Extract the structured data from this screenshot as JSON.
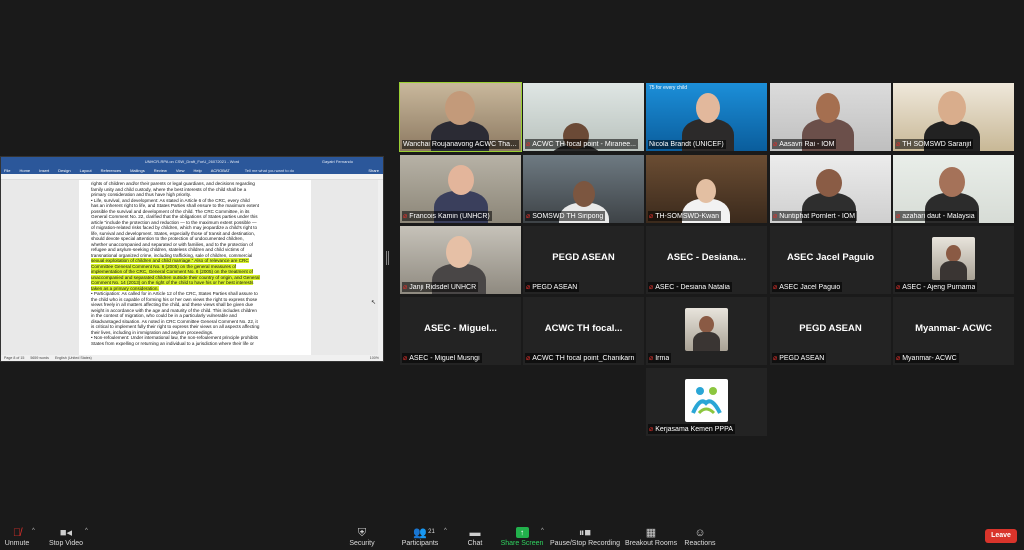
{
  "shared_doc": {
    "title": "UNHCR-RPA on CSW_Draft_ForU_26072021 - Word",
    "user": "Gayatri Fernando",
    "ribbon": [
      "File",
      "Home",
      "Insert",
      "Design",
      "Layout",
      "References",
      "Mailings",
      "Review",
      "View",
      "Help",
      "ACROBAT"
    ],
    "tell_me": "Tell me what you want to do",
    "share": "Share",
    "status": {
      "page": "Page 8 of 15",
      "words": "5659 words",
      "language": "English (United States)",
      "zoom": "100%"
    },
    "lines": [
      {
        "n": "",
        "text": "rights of children and/or their parents or legal guardians, and decisions regarding",
        "hl": false
      },
      {
        "n": "",
        "text": "family unity and child custody, where the best interests of the child shall be a",
        "hl": false
      },
      {
        "n": "",
        "text": "primary consideration and thus have high priority.",
        "hl": false
      },
      {
        "n": "",
        "text": "• Life, survival, and development: As stated in Article 6 of the CRC, every child",
        "hl": false
      },
      {
        "n": "",
        "text": "has an inherent right to life, and States Parties shall ensure to the maximum extent",
        "hl": false
      },
      {
        "n": "",
        "text": "possible the survival and development of the child. The CRC Committee, in its",
        "hl": false
      },
      {
        "n": "",
        "text": "General Comment No. 22, clarified that the obligations of States parties under this",
        "hl": false
      },
      {
        "n": "",
        "text": "article \"include the protection and reduction — to the maximum extent possible —",
        "hl": false
      },
      {
        "n": "",
        "text": "of migration-related risks faced by children, which may jeopardize a child's right to",
        "hl": false
      },
      {
        "n": "",
        "text": "life, survival and development. States, especially those of transit and destination,",
        "hl": false
      },
      {
        "n": "",
        "text": "should devote special attention to the protection of undocumented children,",
        "hl": false
      },
      {
        "n": "",
        "text": "whether unaccompanied and separated or with families, and to the protection of",
        "hl": false
      },
      {
        "n": "",
        "text": "refugee and asylum-seeking children, stateless children and child victims of",
        "hl": false
      },
      {
        "n": "",
        "text": "transnational organized crime, including trafficking, sale of children, commercial",
        "hl": false
      },
      {
        "n": "19",
        "text": "sexual exploitation of children and child marriage.\" Also of relevance are CRC",
        "hl": true
      },
      {
        "n": "20",
        "text": "Committee General Comment No. 6 (2005) on the general measures of",
        "hl": true
      },
      {
        "n": "21",
        "text": "implementation of the CRC, General Comment No. 6 (2005) on the treatment of",
        "hl": true
      },
      {
        "n": "22",
        "text": "unaccompanied and separated children outside their country of origin, and General",
        "hl": true
      },
      {
        "n": "23",
        "text": "Comment No. 14 (2013) on the right of the child to have his or her best interests",
        "hl": true
      },
      {
        "n": "24",
        "text": "taken as a primary consideration.",
        "hl": true
      },
      {
        "n": "25",
        "text": "• Participation: As called for in Article 12 of the CRC, States Parties shall assure to",
        "hl": false
      },
      {
        "n": "26",
        "text": "the child who is capable of forming his or her own views the right to express those",
        "hl": false
      },
      {
        "n": "27",
        "text": "views freely in all matters affecting the child, and these views shall be given due",
        "hl": false
      },
      {
        "n": "28",
        "text": "weight in accordance with the age and maturity of the child. This includes children",
        "hl": false
      },
      {
        "n": "29",
        "text": "in the context of migration, who could be in a particularly vulnerable and",
        "hl": false
      },
      {
        "n": "30",
        "text": "disadvantaged situation. As noted in CRC Committee General Comment No. 22, it",
        "hl": false
      },
      {
        "n": "31",
        "text": "is critical to implement fully their right to express their views on all aspects affecting",
        "hl": false
      },
      {
        "n": "32",
        "text": "their lives, including in immigration and asylum proceedings.",
        "hl": false
      },
      {
        "n": "33",
        "text": "• Non-refoulement: Under international law, the non-refoulement principle prohibits",
        "hl": false
      },
      {
        "n": "34",
        "text": "States from expelling or returning an individual to a jurisdiction where their life or",
        "hl": false
      }
    ]
  },
  "participants": [
    {
      "label": "Wanchai Roujanavong ACWC Thaila...",
      "video": true,
      "active": true,
      "mic_muted": false
    },
    {
      "label": "ACWC TH focal point - Miranee...",
      "video": true,
      "mic_muted": true
    },
    {
      "label": "Nicola Brandt (UNICEF)",
      "video": true,
      "mic_muted": false,
      "overlay": "75 for every child"
    },
    {
      "label": "Aasavri Rai - IOM",
      "video": true,
      "mic_muted": true
    },
    {
      "label": "TH SOMSWD Saranjit",
      "video": true,
      "mic_muted": true
    },
    {
      "label": "Francois Kamin (UNHCR)",
      "video": true,
      "mic_muted": true
    },
    {
      "label": "SOMSWD TH Siripong",
      "video": true,
      "mic_muted": true
    },
    {
      "label": "TH-SOMSWD-Kwan",
      "video": true,
      "mic_muted": true
    },
    {
      "label": "Nuntiphat Pornlert - IOM",
      "video": true,
      "mic_muted": true
    },
    {
      "label": "azahari daut - Malaysia",
      "video": true,
      "mic_muted": true
    },
    {
      "label": "Janji Ridsdel UNHCR",
      "video": true,
      "mic_muted": true
    },
    {
      "label": "PEGD ASEAN",
      "center": "PEGD ASEAN",
      "video": false,
      "mic_muted": true
    },
    {
      "label": "ASEC - Desiana Natalia",
      "center": "ASEC - Desiana...",
      "video": false,
      "mic_muted": true
    },
    {
      "label": "ASEC Jacel Paguio",
      "center": "ASEC Jacel Paguio",
      "video": false,
      "mic_muted": true
    },
    {
      "label": "ASEC - Ajeng Purnama",
      "video": false,
      "avatar": true,
      "mic_muted": true
    },
    {
      "label": "ASEC - Miguel Musngi",
      "center": "ASEC - Miguel...",
      "video": false,
      "mic_muted": true
    },
    {
      "label": "ACWC TH focal point_Chanikarn",
      "center": "ACWC TH focal...",
      "video": false,
      "mic_muted": true
    },
    {
      "label": "Irma",
      "video": false,
      "avatar": true,
      "mic_muted": true
    },
    {
      "label": "PEGD ASEAN",
      "center": "PEGD ASEAN",
      "video": false,
      "mic_muted": true
    },
    {
      "label": "Myanmar- ACWC",
      "center": "Myanmar- ACWC",
      "video": false,
      "mic_muted": true
    },
    {
      "label": "Kerjasama Kemen PPPA",
      "video": false,
      "avatar": true,
      "logo": true,
      "mic_muted": true
    }
  ],
  "toolbar": {
    "unmute": "Unmute",
    "stop_video": "Stop Video",
    "security": "Security",
    "participants": "Participants",
    "participants_count": "21",
    "chat": "Chat",
    "share_screen": "Share Screen",
    "pause_recording": "Pause/Stop Recording",
    "breakout_rooms": "Breakout Rooms",
    "reactions": "Reactions",
    "leave": "Leave"
  },
  "colors": {
    "active_speaker": "#9bd034",
    "muted_mic": "#e0302b",
    "leave": "#d9342b",
    "share_green": "#22b14c",
    "word_blue": "#2b579a",
    "highlight": "#d8f22a"
  }
}
